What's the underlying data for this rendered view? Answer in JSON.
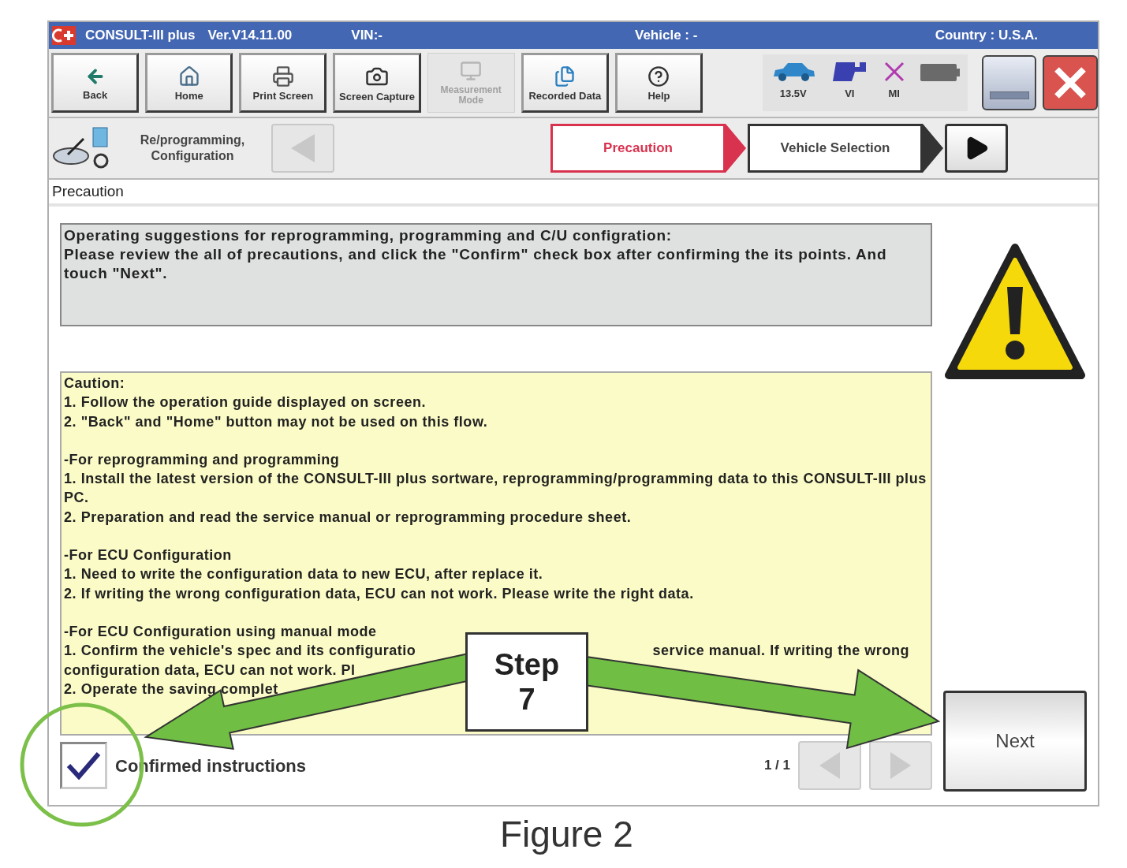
{
  "title_bar": {
    "app": "CONSULT-III plus",
    "version": "Ver.V14.11.00",
    "vin": "VIN:-",
    "vehicle": "Vehicle : -",
    "country": "Country : U.S.A."
  },
  "toolbar": [
    {
      "label": "Back",
      "kind": "back",
      "disabled": false
    },
    {
      "label": "Home",
      "kind": "home",
      "disabled": false
    },
    {
      "label": "Print Screen",
      "kind": "print",
      "disabled": false
    },
    {
      "label": "Screen Capture",
      "kind": "camera",
      "disabled": false
    },
    {
      "label": "Measurement Mode",
      "kind": "measure",
      "disabled": true
    },
    {
      "label": "Recorded Data",
      "kind": "recorded",
      "disabled": false
    },
    {
      "label": "Help",
      "kind": "help",
      "disabled": false
    }
  ],
  "status": {
    "voltage": "13.5V",
    "vi": "VI",
    "mi": "MI"
  },
  "nav": {
    "function": "Re/programming, Configuration",
    "steps": [
      {
        "label": "Precaution",
        "selected": true
      },
      {
        "label": "Vehicle Selection",
        "selected": false
      }
    ]
  },
  "section_title": "Precaution",
  "instructions": [
    "Operating suggestions for reprogramming, programming and C/U configration:",
    "Please review the all of precautions, and click the \"Confirm\" check box after confirming the its points. And touch \"Next\"."
  ],
  "caution": {
    "groups": [
      {
        "lines": [
          {
            "parts": [
              "Caution:"
            ]
          },
          {
            "parts": [
              "1. Follow the operation guide displayed on screen."
            ]
          },
          {
            "parts": [
              "2. \"Back\" and  \"Home\" button may not be used on this flow."
            ]
          }
        ]
      },
      {
        "lines": [
          {
            "parts": [
              "-For reprogramming  and programming"
            ]
          },
          {
            "parts": [
              "1. Install the latest version of the CONSULT-III plus sortware, reprogramming/programming data to this CONSULT-III plus PC."
            ]
          },
          {
            "parts": [
              "2. Preparation and read the service manual or reprogramming procedure sheet."
            ]
          }
        ]
      },
      {
        "lines": [
          {
            "parts": [
              "-For ECU Configuration"
            ]
          },
          {
            "parts": [
              "1. Need to write the configuration data to new ECU, after replace it."
            ]
          },
          {
            "parts": [
              "2. If writing the wrong configuration data, ECU can not work. Please write the right data."
            ]
          }
        ]
      },
      {
        "lines": [
          {
            "parts": [
              "-For ECU Configuration using manual mode"
            ]
          },
          {
            "parts": [
              "1. Confirm the vehicle's spec and its configuratio",
              "service manual.  If writing the wrong"
            ]
          },
          {
            "parts": [
              "configuration data, ECU can not work. Pl"
            ]
          },
          {
            "parts": [
              "2. Operate the saving complet"
            ]
          }
        ]
      }
    ]
  },
  "confirm": {
    "label": "Confirmed instructions",
    "checked": true
  },
  "page": "1 / 1",
  "next": "Next",
  "callout": "Step 7",
  "caption": "Figure 2"
}
